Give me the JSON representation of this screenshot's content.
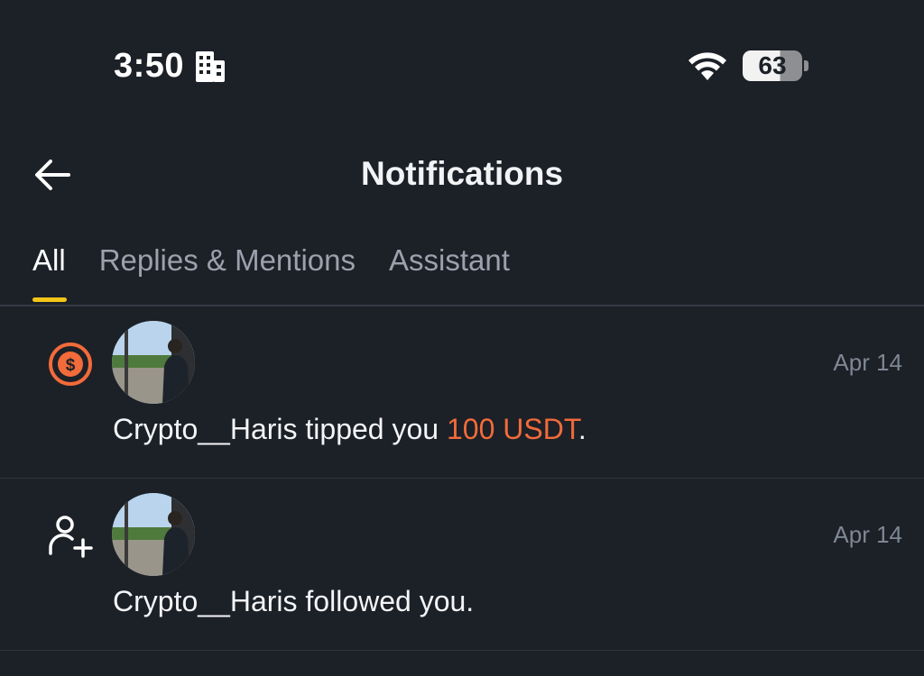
{
  "status_bar": {
    "time": "3:50",
    "battery": "63"
  },
  "header": {
    "title": "Notifications"
  },
  "tabs": [
    {
      "label": "All",
      "active": true
    },
    {
      "label": "Replies & Mentions",
      "active": false
    },
    {
      "label": "Assistant",
      "active": false
    }
  ],
  "notifications": [
    {
      "type_icon": "dollar-coin-icon",
      "user": "Crypto__Haris",
      "text_before": "Crypto__Haris tipped you ",
      "amount": "100 USDT",
      "text_after": ".",
      "date": "Apr 14"
    },
    {
      "type_icon": "follow-user-icon",
      "user": "Crypto__Haris",
      "text": "Crypto__Haris followed you.",
      "date": "Apr 14"
    }
  ],
  "colors": {
    "background": "#1c2027",
    "accent_tab": "#f5c518",
    "tip_amount": "#f26b3a"
  }
}
